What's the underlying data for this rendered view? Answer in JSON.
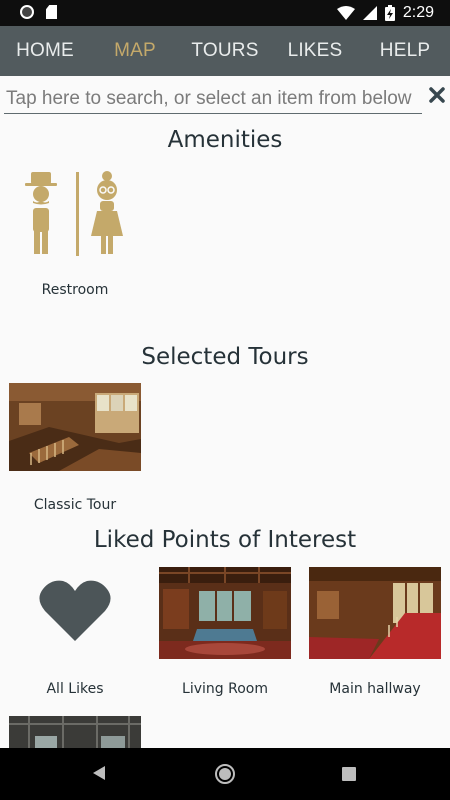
{
  "status_bar": {
    "time": "2:29"
  },
  "nav": {
    "items": [
      {
        "label": "HOME"
      },
      {
        "label": "MAP"
      },
      {
        "label": "TOURS"
      },
      {
        "label": "LIKES"
      },
      {
        "label": "HELP"
      }
    ],
    "active": "MAP",
    "active_color": "#c4a96a"
  },
  "search": {
    "placeholder": "Tap here to search, or select an item from below",
    "value": ""
  },
  "sections": {
    "amenities": {
      "title": "Amenities",
      "items": [
        {
          "label": "Restroom",
          "icon": "restroom-icon"
        }
      ]
    },
    "tours": {
      "title": "Selected Tours",
      "items": [
        {
          "label": "Classic Tour",
          "image": "staircase-photo"
        }
      ]
    },
    "likes": {
      "title": "Liked Points of Interest",
      "items": [
        {
          "label": "All Likes",
          "icon": "heart-icon"
        },
        {
          "label": "Living Room",
          "image": "living-room-photo"
        },
        {
          "label": "Main hallway",
          "image": "hallway-photo"
        },
        {
          "label": "",
          "image": "ceiling-photo"
        }
      ]
    }
  },
  "colors": {
    "navbar": "#525b5e",
    "accent": "#c4a96a",
    "heart": "#4c5558"
  }
}
